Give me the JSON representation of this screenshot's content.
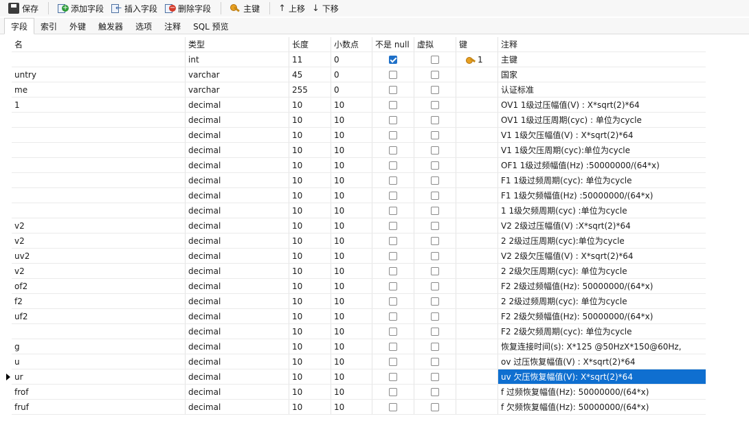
{
  "toolbar": {
    "save": "保存",
    "add_field": "添加字段",
    "insert_field": "插入字段",
    "delete_field": "删除字段",
    "primary_key": "主键",
    "move_up": "上移",
    "move_down": "下移"
  },
  "tabs": [
    "字段",
    "索引",
    "外键",
    "触发器",
    "选项",
    "注释",
    "SQL 预览"
  ],
  "columns": {
    "name": "名",
    "type": "类型",
    "length": "长度",
    "decimals": "小数点",
    "not_null": "不是 null",
    "virtual": "虚拟",
    "key": "键",
    "comment": "注释"
  },
  "rows": [
    {
      "name": "",
      "type": "int",
      "length": "11",
      "decimals": "0",
      "not_null": true,
      "virtual": false,
      "key": "1",
      "comment": "主键"
    },
    {
      "name": "untry",
      "type": "varchar",
      "length": "45",
      "decimals": "0",
      "not_null": false,
      "virtual": false,
      "key": "",
      "comment": "国家"
    },
    {
      "name": "me",
      "type": "varchar",
      "length": "255",
      "decimals": "0",
      "not_null": false,
      "virtual": false,
      "key": "",
      "comment": "认证标准"
    },
    {
      "name": "1",
      "type": "decimal",
      "length": "10",
      "decimals": "10",
      "not_null": false,
      "virtual": false,
      "key": "",
      "comment": "OV1  1级过压幅值(V) : X*sqrt(2)*64"
    },
    {
      "name": "",
      "type": "decimal",
      "length": "10",
      "decimals": "10",
      "not_null": false,
      "virtual": false,
      "key": "",
      "comment": "OV1  1级过压周期(cyc) : 单位为cycle"
    },
    {
      "name": "",
      "type": "decimal",
      "length": "10",
      "decimals": "10",
      "not_null": false,
      "virtual": false,
      "key": "",
      "comment": "V1  1级欠压幅值(V) : X*sqrt(2)*64"
    },
    {
      "name": "",
      "type": "decimal",
      "length": "10",
      "decimals": "10",
      "not_null": false,
      "virtual": false,
      "key": "",
      "comment": "V1  1级欠压周期(cyc):单位为cycle"
    },
    {
      "name": "",
      "type": "decimal",
      "length": "10",
      "decimals": "10",
      "not_null": false,
      "virtual": false,
      "key": "",
      "comment": "OF1  1级过频幅值(Hz) :50000000/(64*x)"
    },
    {
      "name": "",
      "type": "decimal",
      "length": "10",
      "decimals": "10",
      "not_null": false,
      "virtual": false,
      "key": "",
      "comment": "F1   1级过频周期(cyc): 单位为cycle"
    },
    {
      "name": "",
      "type": "decimal",
      "length": "10",
      "decimals": "10",
      "not_null": false,
      "virtual": false,
      "key": "",
      "comment": "F1   1级欠频幅值(Hz) :50000000/(64*x)"
    },
    {
      "name": "",
      "type": "decimal",
      "length": "10",
      "decimals": "10",
      "not_null": false,
      "virtual": false,
      "key": "",
      "comment": "1   1级欠频周期(cyc) :单位为cycle"
    },
    {
      "name": "v2",
      "type": "decimal",
      "length": "10",
      "decimals": "10",
      "not_null": false,
      "virtual": false,
      "key": "",
      "comment": "V2 2级过压幅值(V) :X*sqrt(2)*64"
    },
    {
      "name": "v2",
      "type": "decimal",
      "length": "10",
      "decimals": "10",
      "not_null": false,
      "virtual": false,
      "key": "",
      "comment": "2  2级过压周期(cyc):单位为cycle"
    },
    {
      "name": "uv2",
      "type": "decimal",
      "length": "10",
      "decimals": "10",
      "not_null": false,
      "virtual": false,
      "key": "",
      "comment": "V2  2级欠压幅值(V) : X*sqrt(2)*64"
    },
    {
      "name": "v2",
      "type": "decimal",
      "length": "10",
      "decimals": "10",
      "not_null": false,
      "virtual": false,
      "key": "",
      "comment": "2  2级欠压周期(cyc): 单位为cycle"
    },
    {
      "name": "of2",
      "type": "decimal",
      "length": "10",
      "decimals": "10",
      "not_null": false,
      "virtual": false,
      "key": "",
      "comment": "F2  2级过频幅值(Hz): 50000000/(64*x)"
    },
    {
      "name": "f2",
      "type": "decimal",
      "length": "10",
      "decimals": "10",
      "not_null": false,
      "virtual": false,
      "key": "",
      "comment": "2   2级过频周期(cyc): 单位为cycle"
    },
    {
      "name": "uf2",
      "type": "decimal",
      "length": "10",
      "decimals": "10",
      "not_null": false,
      "virtual": false,
      "key": "",
      "comment": "F2  2级欠频幅值(Hz): 50000000/(64*x)"
    },
    {
      "name": "",
      "type": "decimal",
      "length": "10",
      "decimals": "10",
      "not_null": false,
      "virtual": false,
      "key": "",
      "comment": "F2  2级欠频周期(cyc): 单位为cycle"
    },
    {
      "name": "g",
      "type": "decimal",
      "length": "10",
      "decimals": "10",
      "not_null": false,
      "virtual": false,
      "key": "",
      "comment": "      恢复连接时间(s): X*125 @50HzX*150@60Hz,"
    },
    {
      "name": "u",
      "type": "decimal",
      "length": "10",
      "decimals": "10",
      "not_null": false,
      "virtual": false,
      "key": "",
      "comment": "ov 过压恢复幅值(V) : X*sqrt(2)*64"
    },
    {
      "name": "ur",
      "type": "decimal",
      "length": "10",
      "decimals": "10",
      "not_null": false,
      "virtual": false,
      "key": "",
      "comment": "uv  欠压恢复幅值(V): X*sqrt(2)*64"
    },
    {
      "name": "frof",
      "type": "decimal",
      "length": "10",
      "decimals": "10",
      "not_null": false,
      "virtual": false,
      "key": "",
      "comment": "f   过频恢复幅值(Hz): 50000000/(64*x)"
    },
    {
      "name": "fruf",
      "type": "decimal",
      "length": "10",
      "decimals": "10",
      "not_null": false,
      "virtual": false,
      "key": "",
      "comment": "f   欠频恢复幅值(Hz): 50000000/(64*x)"
    }
  ],
  "selected_row": 21
}
